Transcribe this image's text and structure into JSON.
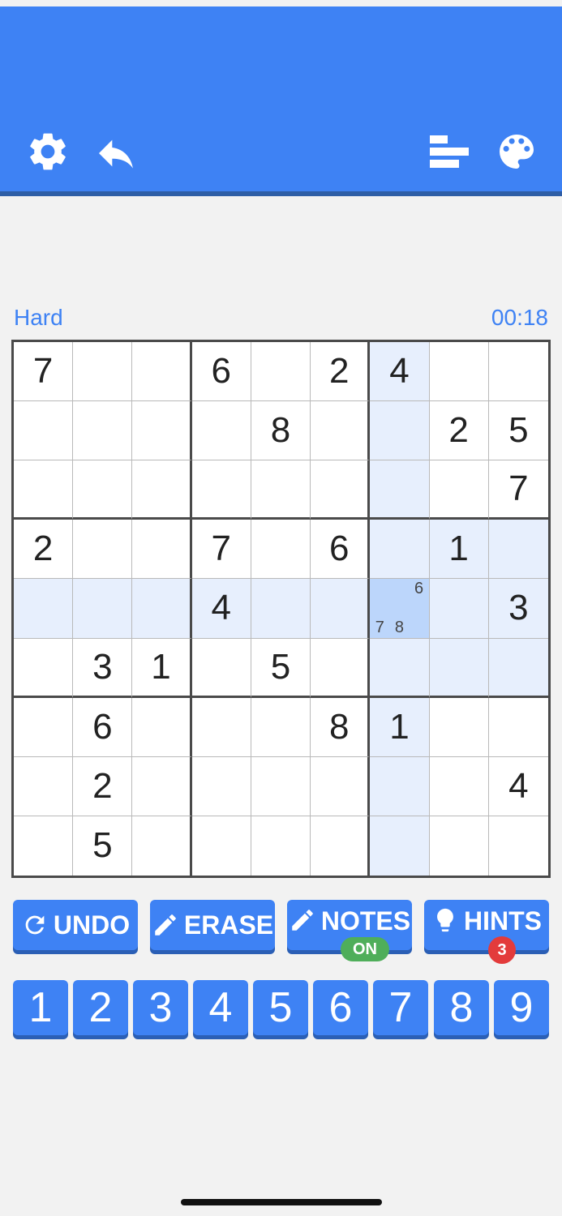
{
  "header": {
    "icons": [
      "gear-icon",
      "undo-arrow-icon",
      "bar-chart-icon",
      "palette-icon"
    ],
    "bg_color": "#3e82f4"
  },
  "game": {
    "difficulty": "Hard",
    "timer": "00:18"
  },
  "board": {
    "rows": [
      [
        "7",
        "",
        "",
        "6",
        "",
        "2",
        "4",
        "",
        ""
      ],
      [
        "",
        "",
        "",
        "",
        "8",
        "",
        "",
        "2",
        "5"
      ],
      [
        "",
        "",
        "",
        "",
        "",
        "",
        "",
        "",
        "7"
      ],
      [
        "2",
        "",
        "",
        "7",
        "",
        "6",
        "",
        "1",
        ""
      ],
      [
        "",
        "",
        "",
        "4",
        "",
        "",
        "",
        "",
        "3"
      ],
      [
        "",
        "3",
        "1",
        "",
        "5",
        "",
        "",
        "",
        ""
      ],
      [
        "",
        "6",
        "",
        "",
        "",
        "8",
        "1",
        "",
        ""
      ],
      [
        "",
        "2",
        "",
        "",
        "",
        "",
        "",
        "",
        "4"
      ],
      [
        "",
        "5",
        "",
        "",
        "",
        "",
        "",
        "",
        ""
      ]
    ],
    "selected": {
      "row": 4,
      "col": 6
    },
    "selected_notes": [
      "",
      "",
      "6",
      "",
      "",
      "",
      "7",
      "8",
      ""
    ]
  },
  "actions": {
    "undo_label": "UNDO",
    "erase_label": "ERASE",
    "notes_label": "NOTES",
    "notes_state": "ON",
    "hints_label": "HINTS",
    "hints_count": "3"
  },
  "numpad": [
    "1",
    "2",
    "3",
    "4",
    "5",
    "6",
    "7",
    "8",
    "9"
  ]
}
